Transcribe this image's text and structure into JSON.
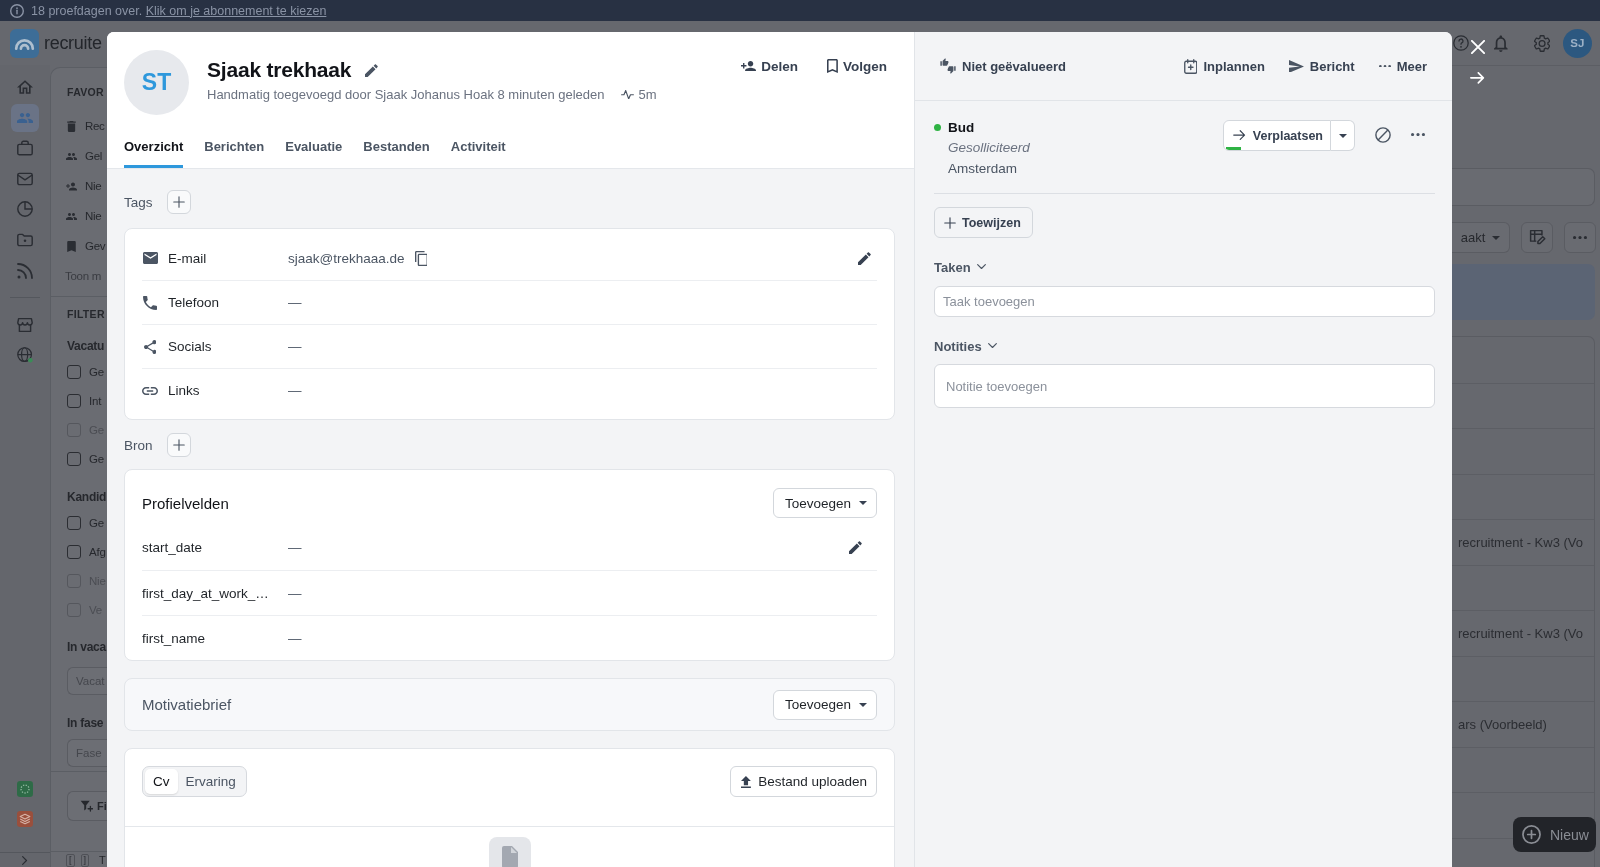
{
  "banner": {
    "text": "18 proefdagen over.",
    "link": "Klik om je abonnement te kiezen"
  },
  "topbar": {
    "logo_text": "recruite",
    "avatar": "SJ"
  },
  "rail": {
    "main": [
      {
        "selected": false
      },
      {
        "selected": true
      },
      {
        "selected": false
      },
      {
        "selected": false
      },
      {
        "selected": false
      },
      {
        "selected": false
      },
      {
        "selected": false
      }
    ],
    "extra": [
      {
        "selected": false
      },
      {
        "selected": false
      }
    ]
  },
  "sidebar": {
    "favorites_heading": "FAVOR",
    "favorites": [
      {
        "label": "Rec"
      },
      {
        "label": "Gel"
      },
      {
        "label": "Nie"
      },
      {
        "label": "Nie"
      },
      {
        "label": "Gev"
      }
    ],
    "show_more": "Toon m",
    "filters_heading": "FILTER",
    "filter_groups": [
      {
        "title": "Vacatu",
        "options": [
          {
            "label": "Ge",
            "checked": false,
            "disabled": false
          },
          {
            "label": "Int",
            "checked": false,
            "disabled": false
          },
          {
            "label": "Ge",
            "checked": false,
            "disabled": true
          },
          {
            "label": "Ge",
            "checked": false,
            "disabled": false
          }
        ]
      },
      {
        "title": "Kandid",
        "options": [
          {
            "label": "Ge",
            "checked": false,
            "disabled": false
          },
          {
            "label": "Afg",
            "checked": false,
            "disabled": false
          },
          {
            "label": "Nie",
            "checked": false,
            "disabled": true
          },
          {
            "label": "Ve",
            "checked": false,
            "disabled": true
          }
        ]
      }
    ],
    "selects": [
      {
        "label": "In vaca",
        "placeholder": "Vacat"
      },
      {
        "label": "In fase",
        "placeholder": "Fase"
      }
    ],
    "filter_button": "Fi",
    "shortcut_keys": [
      "[",
      "]"
    ],
    "shortcut_text": "T"
  },
  "list": {
    "filter_button": "aakt",
    "rows": [
      {
        "kind": "empty"
      },
      {
        "kind": "empty"
      },
      {
        "kind": "empty"
      },
      {
        "kind": "empty"
      },
      {
        "kind": "text",
        "text": "recruitment - Kw3 (Vo"
      },
      {
        "kind": "empty"
      },
      {
        "kind": "text",
        "text": "recruitment - Kw3 (Vo"
      },
      {
        "kind": "empty"
      },
      {
        "kind": "text",
        "text": "ars (Voorbeeld)"
      },
      {
        "kind": "empty"
      },
      {
        "kind": "empty"
      },
      {
        "kind": "empty"
      }
    ],
    "new_button": "Nieuw"
  },
  "candidate": {
    "initials": "ST",
    "name": "Sjaak trekhaak",
    "subtitle": "Handmatig toegevoegd door Sjaak Johanus Hoak 8 minuten geleden",
    "activity": "5m",
    "actions": [
      {
        "label": "Delen"
      },
      {
        "label": "Volgen"
      }
    ]
  },
  "tabs": [
    {
      "label": "Overzicht",
      "selected": true
    },
    {
      "label": "Berichten",
      "selected": false
    },
    {
      "label": "Evaluatie",
      "selected": false
    },
    {
      "label": "Bestanden",
      "selected": false
    },
    {
      "label": "Activiteit",
      "selected": false
    }
  ],
  "tags": {
    "label": "Tags"
  },
  "contact": [
    {
      "label": "E-mail",
      "value": "sjaak@trekhaaa.de",
      "copyable": true,
      "hovered": true
    },
    {
      "label": "Telefoon",
      "value": "—",
      "copyable": false,
      "hovered": false
    },
    {
      "label": "Socials",
      "value": "—",
      "copyable": false,
      "hovered": false
    },
    {
      "label": "Links",
      "value": "—",
      "copyable": false,
      "hovered": false
    }
  ],
  "source": {
    "label": "Bron"
  },
  "profile_fields": {
    "title": "Profielvelden",
    "add_button": "Toevoegen",
    "rows": [
      {
        "label": "start_date",
        "value": "—",
        "hovered": true
      },
      {
        "label": "first_day_at_work_…",
        "value": "—",
        "hovered": false
      },
      {
        "label": "first_name",
        "value": "—",
        "hovered": false
      }
    ]
  },
  "cover_letter": {
    "title": "Motivatiebrief",
    "add_button": "Toevoegen"
  },
  "documents": {
    "segments": [
      {
        "label": "Cv",
        "selected": true
      },
      {
        "label": "Ervaring",
        "selected": false
      }
    ],
    "upload_button": "Bestand uploaden"
  },
  "sidepanel": {
    "evaluation": "Niet geëvalueerd",
    "actions": [
      {
        "label": "Inplannen"
      },
      {
        "label": "Bericht"
      },
      {
        "label": "Meer"
      }
    ],
    "applications": [
      {
        "vacancy": "Bud",
        "color": "#2fb344",
        "stage": "Gesolliciteerd",
        "location": "Amsterdam",
        "move_button": "Verplaatsen",
        "level": 0.15
      }
    ],
    "assign_button": "Toewijzen",
    "tasks": {
      "label": "Taken",
      "expanded": true,
      "placeholder": "Taak toevoegen"
    },
    "notes": {
      "label": "Notities",
      "expanded": true,
      "placeholder": "Notitie toevoegen"
    }
  }
}
